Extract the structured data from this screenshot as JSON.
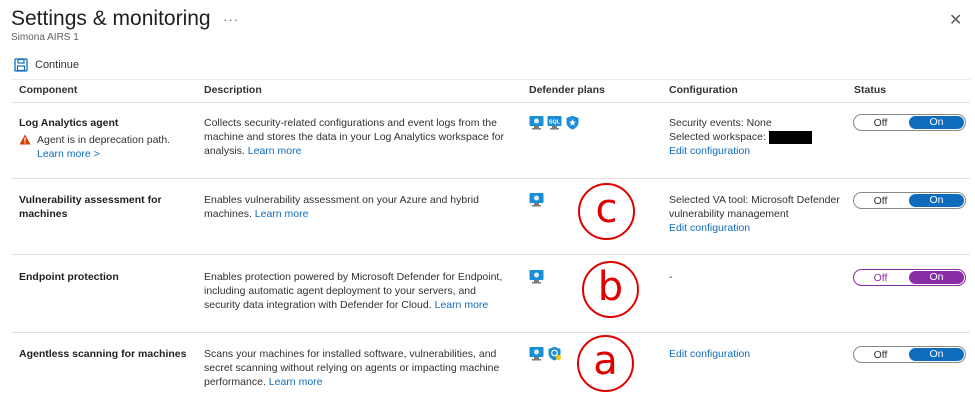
{
  "header": {
    "title": "Settings & monitoring",
    "more": "···",
    "subtitle": "Simona AIRS 1",
    "close": "✕"
  },
  "toolbar": {
    "continue_label": "Continue"
  },
  "table": {
    "headers": {
      "component": "Component",
      "description": "Description",
      "plans": "Defender plans",
      "configuration": "Configuration",
      "status": "Status"
    },
    "rows": [
      {
        "name": "Log Analytics agent",
        "warning": "Agent is in deprecation path.",
        "learn_more_arrow": "Learn more >",
        "desc": "Collects security-related configurations and event logs from the machine and stores the data in your Log Analytics workspace for analysis.",
        "desc_link": "Learn more",
        "cfg_line1": "Security events: None",
        "cfg_line2": "Selected workspace:",
        "cfg_link": "Edit configuration",
        "toggle_off": "Off",
        "toggle_on": "On",
        "plan_icons": [
          "server-icon",
          "sql-server-icon",
          "shield-star-icon"
        ]
      },
      {
        "name": "Vulnerability assessment for machines",
        "desc": "Enables vulnerability assessment on your Azure and hybrid machines.",
        "desc_link": "Learn more",
        "cfg_line1": "Selected VA tool: Microsoft Defender vulnerability management",
        "cfg_link": "Edit configuration",
        "toggle_off": "Off",
        "toggle_on": "On",
        "plan_icons": [
          "server-icon"
        ],
        "annotation": "c"
      },
      {
        "name": "Endpoint protection",
        "desc": "Enables protection powered by Microsoft Defender for Endpoint, including automatic agent deployment to your servers, and security data integration with Defender for Cloud.",
        "desc_link": "Learn more",
        "cfg_line1": "-",
        "toggle_off": "Off",
        "toggle_on": "On",
        "plan_icons": [
          "server-icon"
        ],
        "annotation": "b"
      },
      {
        "name": "Agentless scanning for machines",
        "desc": "Scans your machines for installed software, vulnerabilities, and secret scanning without relying on agents or impacting machine performance.",
        "desc_link": "Learn more",
        "cfg_link": "Edit configuration",
        "toggle_off": "Off",
        "toggle_on": "On",
        "plan_icons": [
          "server-icon",
          "shield-cloud-icon"
        ],
        "annotation": "a"
      }
    ]
  },
  "colors": {
    "accent_blue": "#0f6cbd",
    "toggle_on_blue": "#0f6cbd",
    "toggle_on_purple": "#8a2da5",
    "annotation_red": "#e00000",
    "warning_orange": "#d83b01"
  }
}
